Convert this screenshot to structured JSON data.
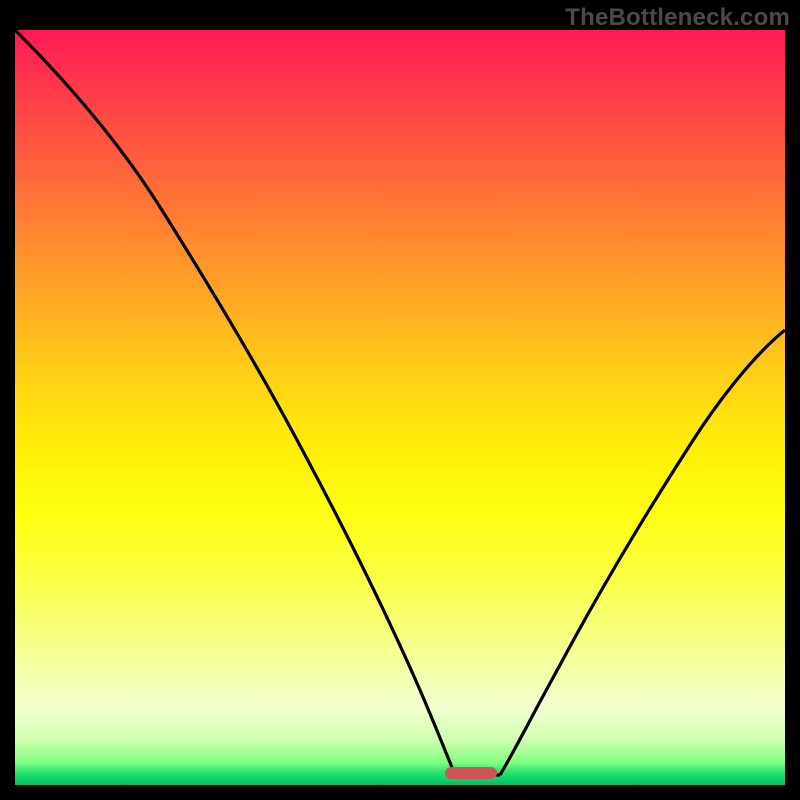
{
  "watermark": "TheBottleneck.com",
  "chart_data": {
    "type": "line",
    "title": "",
    "xlabel": "",
    "ylabel": "",
    "xlim": [
      0,
      100
    ],
    "ylim": [
      0,
      100
    ],
    "gradient_stops": [
      {
        "pos": 0,
        "color": "#ff1a55"
      },
      {
        "pos": 25,
        "color": "#ff7a34"
      },
      {
        "pos": 50,
        "color": "#ffe010"
      },
      {
        "pos": 80,
        "color": "#f6ff90"
      },
      {
        "pos": 97,
        "color": "#80ff80"
      },
      {
        "pos": 100,
        "color": "#00c060"
      }
    ],
    "series": [
      {
        "name": "left-branch",
        "x": [
          0,
          5,
          10,
          15,
          20,
          25,
          30,
          35,
          40,
          45,
          50,
          53,
          56
        ],
        "y": [
          100,
          95,
          88,
          80,
          71,
          62,
          53,
          44,
          35,
          26,
          16,
          8,
          2
        ]
      },
      {
        "name": "right-branch",
        "x": [
          62,
          66,
          72,
          78,
          85,
          92,
          100
        ],
        "y": [
          2,
          6,
          14,
          24,
          35,
          46,
          58
        ]
      }
    ],
    "optimal_marker": {
      "x_start": 56,
      "x_end": 62,
      "y": 1.5,
      "color": "#cc5555"
    }
  }
}
